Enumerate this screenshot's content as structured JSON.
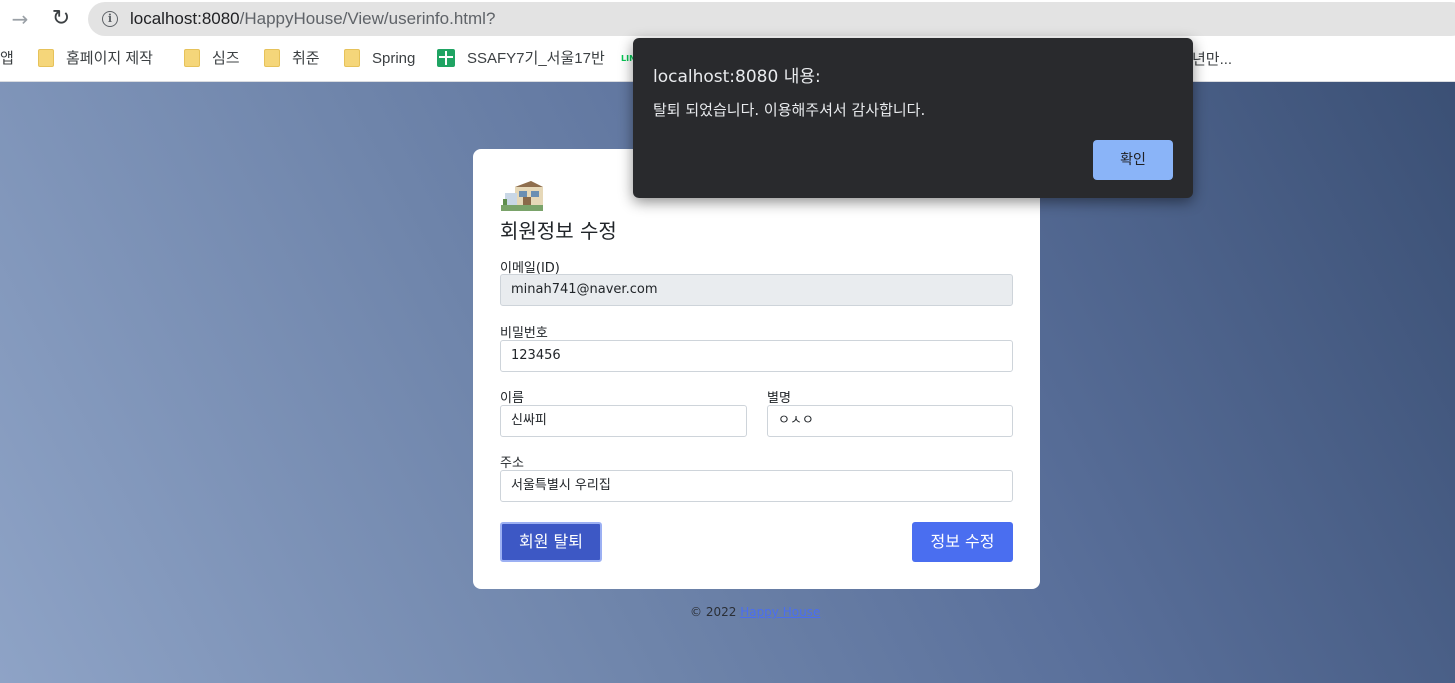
{
  "browser": {
    "url_host": "localhost:8080",
    "url_path": "/HappyHouse/View/userinfo.html?"
  },
  "bookmarks": {
    "apps": "앱",
    "items": [
      "홈페이지 제작",
      "심즈",
      "취준",
      "Spring"
    ],
    "sheet": "SSAFY7기_서울17반",
    "line_icon": "LINE",
    "tail": "년만..."
  },
  "card": {
    "title": "회원정보 수정",
    "email_label": "이메일(ID)",
    "email_value": "minah741@naver.com",
    "password_label": "비밀번호",
    "password_value": "123456",
    "name_label": "이름",
    "name_value": "신싸피",
    "nickname_label": "별명",
    "nickname_value": "ㅇㅅㅇ",
    "address_label": "주소",
    "address_value": "서울특별시 우리집",
    "withdraw_button": "회원 탈퇴",
    "update_button": "정보 수정"
  },
  "footer": {
    "copyright": "© 2022",
    "link": "Happy House"
  },
  "dialog": {
    "title": "localhost:8080 내용:",
    "message": "탈퇴 되었습니다. 이용해주셔서 감사합니다.",
    "ok_button": "확인"
  },
  "colors": {
    "primary": "#4a6ef0",
    "withdraw": "#3d58c5",
    "dialog_bg": "#292a2d",
    "dialog_ok": "#8ab4f8"
  }
}
